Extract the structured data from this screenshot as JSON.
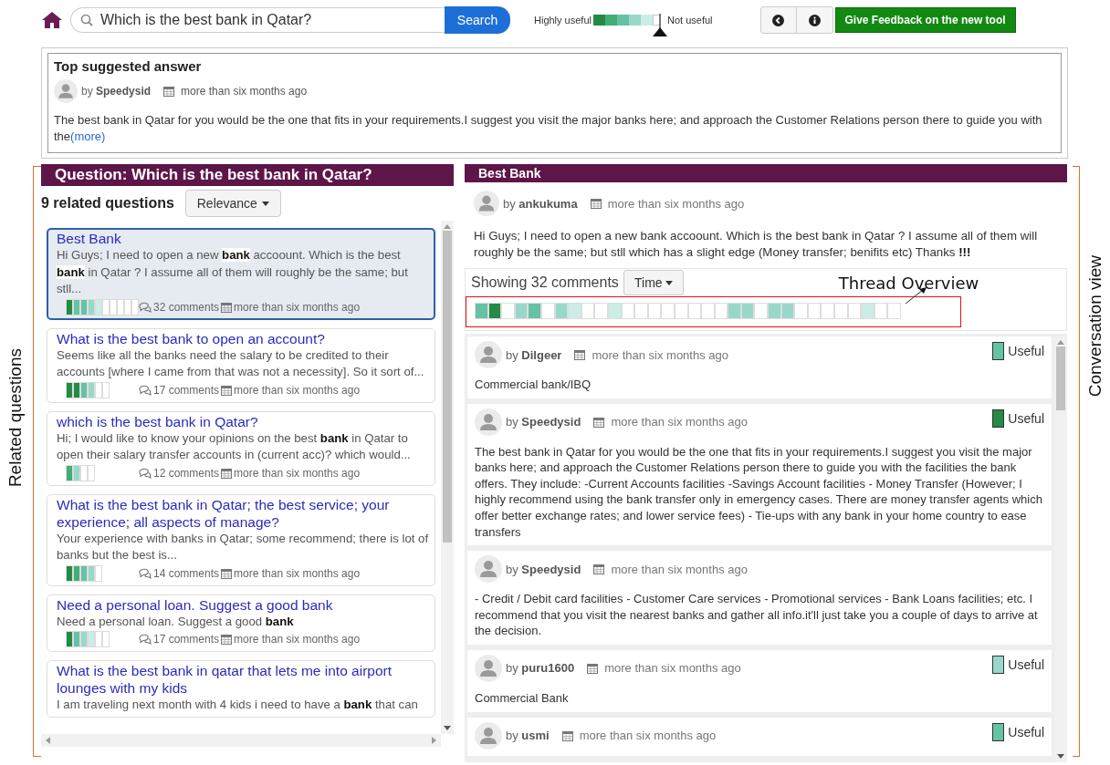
{
  "topbar": {
    "search": {
      "value": "Which is the best bank in Qatar?"
    },
    "search_button": "Search",
    "legend": {
      "high_label": "Highly useful",
      "low_label": "Not useful",
      "swatches": [
        {
          "color": "#238b45"
        },
        {
          "color": "#41ae76"
        },
        {
          "color": "#66c2a4"
        },
        {
          "color": "#99d8c9"
        },
        {
          "color": "#ccece6"
        },
        {
          "color": "#ffffff"
        }
      ]
    },
    "feedback_button": "Give Feedback on the new tool"
  },
  "top_answer": {
    "title": "Top suggested answer",
    "author": "by **Speedysid**",
    "date": "more than six months ago",
    "text": "The best bank in Qatar for you would be the one that fits in your requirements.I suggest you visit the major banks here; and approach the Customer Relations person there to guide you with the",
    "more_link": "(more)"
  },
  "related": {
    "header": "Question: Which is the best bank in Qatar?",
    "count": "9 related questions",
    "sort_button": "Relevance",
    "questions": [
      {
        "title": "Best Bank",
        "snippet": "Hi Guys; I need to open a new **bank** accoount. Which is the best **bank** in Qatar ? I assume all of them will roughly be the same; but stll...",
        "bar": [
          {
            "color": "#238b45"
          },
          {
            "color": "#66c2a4"
          },
          {
            "color": "#66c2a4"
          },
          {
            "color": "#99d8c9"
          },
          {
            "color": "#ccece6"
          },
          {
            "color": "#ffffff"
          },
          {
            "color": "#ffffff"
          },
          {
            "color": "#ffffff"
          },
          {
            "color": "#ffffff"
          },
          {
            "color": "#ffffff"
          }
        ],
        "comments": "32 comments",
        "date": "more than six months ago",
        "selected": true
      },
      {
        "title": "What is the best bank to open an account?",
        "snippet": "Seems like all the banks need the salary to be credited to their accounts [where I came from that was not a necessity]. So it sort of...",
        "bar": [
          {
            "color": "#238b45"
          },
          {
            "color": "#238b45"
          },
          {
            "color": "#66c2a4"
          },
          {
            "color": "#99d8c9"
          },
          {
            "color": "#ffffff"
          },
          {
            "color": "#ffffff"
          }
        ],
        "comments": "17 comments",
        "date": "more than six months ago",
        "selected": false
      },
      {
        "title": "which is the best bank in Qatar?",
        "snippet": "Hi; I would like to know your opinions on the best **bank** in Qatar to open their salary transfer accounts in (current acc)? which would...",
        "bar": [
          {
            "color": "#41ae76"
          },
          {
            "color": "#99d8c9"
          },
          {
            "color": "#ffffff"
          },
          {
            "color": "#ffffff"
          }
        ],
        "comments": "12 comments",
        "date": "more than six months ago",
        "selected": false
      },
      {
        "title": "What is the best bank in Qatar; the best service; your experience; all aspects of manage?",
        "snippet": "Your experience with banks in Qatar; some recommend; there is lot of banks but the best is...",
        "bar": [
          {
            "color": "#238b45"
          },
          {
            "color": "#41ae76"
          },
          {
            "color": "#66c2a4"
          },
          {
            "color": "#99d8c9"
          },
          {
            "color": "#ffffff"
          }
        ],
        "comments": "14 comments",
        "date": "more than six months ago",
        "selected": false
      },
      {
        "title": "Need a personal loan. Suggest a good bank",
        "snippet": "Need a personal loan. Suggest a good **bank**",
        "bar": [
          {
            "color": "#238b45"
          },
          {
            "color": "#66c2a4"
          },
          {
            "color": "#99d8c9"
          },
          {
            "color": "#ccece6"
          },
          {
            "color": "#ffffff"
          },
          {
            "color": "#ffffff"
          }
        ],
        "comments": "17 comments",
        "date": "more than six months ago",
        "selected": false
      },
      {
        "title": "What is the best bank in qatar that lets me into airport lounges with my kids",
        "snippet": "I am traveling next month with 4 kids i need to have a **bank** that can",
        "selected": false
      }
    ]
  },
  "thread": {
    "title": "Best Bank",
    "question": {
      "author": "by **ankukuma**",
      "date": "more than six months ago",
      "text": "Hi Guys; I need to open a new bank accoount. Which is the best bank in Qatar ? I assume all of them will roughly be the same; but stll which has a slight edge (Money transfer; benifits etc) Thanks **!!!**"
    },
    "showing": "Showing 32 comments",
    "sort_button": "Time",
    "overview": {
      "label": "Thread Overview",
      "cells": [
        {
          "color": "#66c2a4"
        },
        {
          "color": "#238b45"
        },
        {
          "color": "#ffffff"
        },
        {
          "color": "#99d8c9"
        },
        {
          "color": "#66c2a4"
        },
        {
          "color": "#ffffff"
        },
        {
          "color": "#99d8c9"
        },
        {
          "color": "#ccece6"
        },
        {
          "color": "#ffffff"
        },
        {
          "color": "#ffffff"
        },
        {
          "color": "#ccece6"
        },
        {
          "color": "#ffffff"
        },
        {
          "color": "#ffffff"
        },
        {
          "color": "#ffffff"
        },
        {
          "color": "#ffffff"
        },
        {
          "color": "#ffffff"
        },
        {
          "color": "#ffffff"
        },
        {
          "color": "#ffffff"
        },
        {
          "color": "#ffffff"
        },
        {
          "color": "#99d8c9"
        },
        {
          "color": "#99d8c9"
        },
        {
          "color": "#ffffff"
        },
        {
          "color": "#99d8c9"
        },
        {
          "color": "#99d8c9"
        },
        {
          "color": "#ffffff"
        },
        {
          "color": "#ffffff"
        },
        {
          "color": "#ffffff"
        },
        {
          "color": "#ffffff"
        },
        {
          "color": "#ffffff"
        },
        {
          "color": "#ccece6"
        },
        {
          "color": "#ffffff"
        },
        {
          "color": "#ffffff"
        }
      ]
    },
    "comments": [
      {
        "author": "by **Dilgeer**",
        "date": "more than six months ago",
        "text": "Commercial bank/IBQ",
        "useful": {
          "label": "Useful",
          "color": "#66c2a4"
        }
      },
      {
        "author": "by **Speedysid**",
        "date": "more than six months ago",
        "text": "The best bank in Qatar for you would be the one that fits in your requirements.I suggest you visit the major banks here; and approach the Customer Relations person there to guide you with the facilities the bank offers. They include: -Current Accounts facilities -Savings Account facilities - Money Transfer (However; I highly recommend using the bank transfer only in emergency cases. There are money transfer agents which offer better exchange rates; and lower service fees) - Tie-ups with any bank in your home country to ease transfers",
        "useful": {
          "label": "Useful",
          "color": "#238b45"
        }
      },
      {
        "author": "by **Speedysid**",
        "date": "more than six months ago",
        "text": "- Credit / Debit card facilities - Customer Care services - Promotional services - Bank Loans facilities; etc. I recommend that you visit the nearest banks and gather all info.it'll just take you a couple of days to arrive at the decision."
      },
      {
        "author": "by **puru1600**",
        "date": "more than six months ago",
        "text": "Commercial Bank",
        "useful": {
          "label": "Useful",
          "color": "#99d8c9"
        }
      },
      {
        "author": "by **usmi**",
        "date": "more than six months ago",
        "useful": {
          "label": "Useful",
          "color": "#66c2a4"
        }
      }
    ]
  },
  "annotations": {
    "left": "Related questions",
    "right": "Conversation view"
  }
}
